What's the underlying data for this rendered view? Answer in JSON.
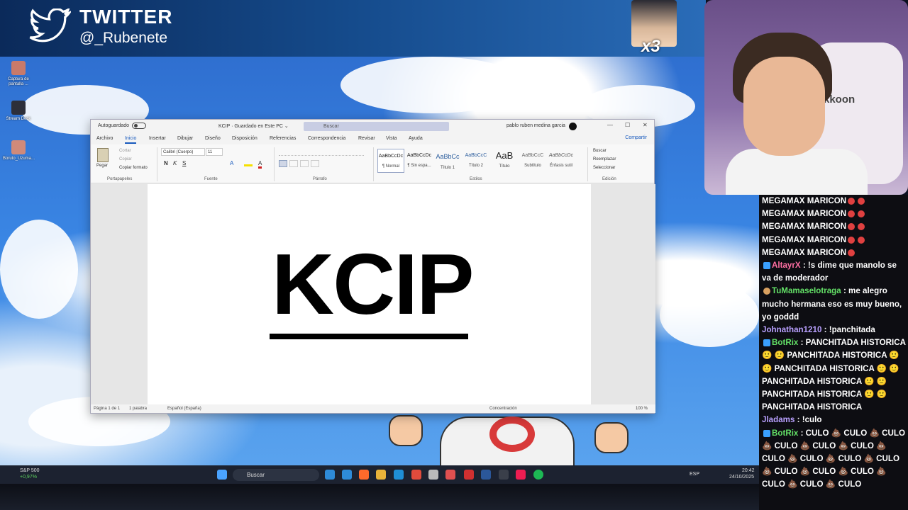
{
  "banner": {
    "title": "TWITTER",
    "handle": "@_Rubenete",
    "emote_label": "x3"
  },
  "desktop_icons": [
    {
      "label": "Captura de pantalla ...",
      "color": "#c87a6a"
    },
    {
      "label": "Stream Deck",
      "color": "#2d2f3a"
    },
    {
      "label": "Boruto_Uzuma...",
      "color": "#d08a7a"
    }
  ],
  "word": {
    "autosave": "Autoguardado",
    "doc_title": "KCIP  ·  Guardado en Este PC  ⌄",
    "search_placeholder": "Buscar",
    "user": "pablo ruben medina garcia",
    "window_buttons": [
      "—",
      "☐",
      "✕"
    ],
    "menu": [
      "Archivo",
      "Inicio",
      "Insertar",
      "Dibujar",
      "Diseño",
      "Disposición",
      "Referencias",
      "Correspondencia",
      "Revisar",
      "Vista",
      "Ayuda"
    ],
    "share": "Compartir",
    "clipboard": {
      "paste": "Pegar",
      "cut": "Cortar",
      "copy": "Copiar",
      "format": "Copiar formato",
      "label": "Portapapeles"
    },
    "font": {
      "name": "Calibri (Cuerpo)",
      "size": "11",
      "label": "Fuente"
    },
    "paragraph_label": "Párrafo",
    "styles_label": "Estilos",
    "styles": [
      {
        "sample": "AaBbCcDc",
        "name": "¶ Normal"
      },
      {
        "sample": "AaBbCcDc",
        "name": "¶ Sin espa..."
      },
      {
        "sample": "AaBbCc",
        "name": "Título 1"
      },
      {
        "sample": "AaBbCcC",
        "name": "Título 2"
      },
      {
        "sample": "AaB",
        "name": "Título"
      },
      {
        "sample": "AaBbCcC",
        "name": "Subtítulo"
      },
      {
        "sample": "AaBbCcDc",
        "name": "Énfasis sutil"
      }
    ],
    "editing": {
      "find": "Buscar",
      "replace": "Reemplazar",
      "select": "Seleccionar",
      "label": "Edición"
    },
    "document_text": "KCIP",
    "status": {
      "page": "Página 1 de 1",
      "words": "1 palabra",
      "lang": "Español (España)",
      "focus": "Concentración",
      "zoom": "100 %"
    }
  },
  "taskbar": {
    "stock": {
      "name": "S&P 500",
      "change": "+0,97%"
    },
    "search": "Buscar",
    "lang": "ESP",
    "time": "20:42",
    "date": "24/10/2025",
    "apps": [
      "#4aa3ff",
      "#2e8bd8",
      "#ff6a2b",
      "#e8b33a",
      "#1f8fd6",
      "#e04b3c",
      "#2a7de1",
      "#1e88e5",
      "#ffffff",
      "#2b579a",
      "#3a3f4a",
      "#ee1d52",
      "#1db954"
    ]
  },
  "webcam": {
    "brand": "kkoon"
  },
  "chat": [
    {
      "text": "MEGAMAX MARICON",
      "emotes": [
        "#e04040",
        "#e04040"
      ]
    },
    {
      "text": "MEGAMAX MARICON",
      "emotes": [
        "#e04040",
        "#e04040"
      ]
    },
    {
      "text": "MEGAMAX MARICON",
      "emotes": [
        "#e04040",
        "#e04040"
      ]
    },
    {
      "text": "MEGAMAX MARICON",
      "emotes": [
        "#e04040",
        "#e04040"
      ]
    },
    {
      "text": "MEGAMAX MARICON",
      "emotes": [
        "#e04040"
      ]
    },
    {
      "user": "AltayrX",
      "color": "#ff6fa3",
      "text": ": !s dime que manolo se va de moderador"
    },
    {
      "user": "TuMamaseIotraga",
      "color": "#63e067",
      "text": ": me alegro mucho hermana eso es muy bueno, yo goddd"
    },
    {
      "user": "Johnathan1210",
      "color": "#b9a0ff",
      "text": ": !panchitada"
    },
    {
      "user": "BotRix",
      "color": "#63e067",
      "text": ": PANCHITADA HISTORICA 🙂 🙂 PANCHITADA HISTORICA 🙂 🙂 PANCHITADA HISTORICA 🙂 🙂 PANCHITADA HISTORICA 🙂 🙂 PANCHITADA HISTORICA 🙂 🙂 PANCHITADA HISTORICA"
    },
    {
      "user": "Jladams",
      "color": "#b9a0ff",
      "text": ": !culo"
    },
    {
      "user": "BotRix",
      "color": "#63e067",
      "text": ": CULO 💩 CULO 💩 CULO 💩 CULO 💩 CULO 💩 CULO 💩 CULO 💩 CULO 💩 CULO 💩 CULO 💩 CULO 💩 CULO 💩 CULO 💩 CULO 💩 CULO 💩 CULO"
    }
  ]
}
